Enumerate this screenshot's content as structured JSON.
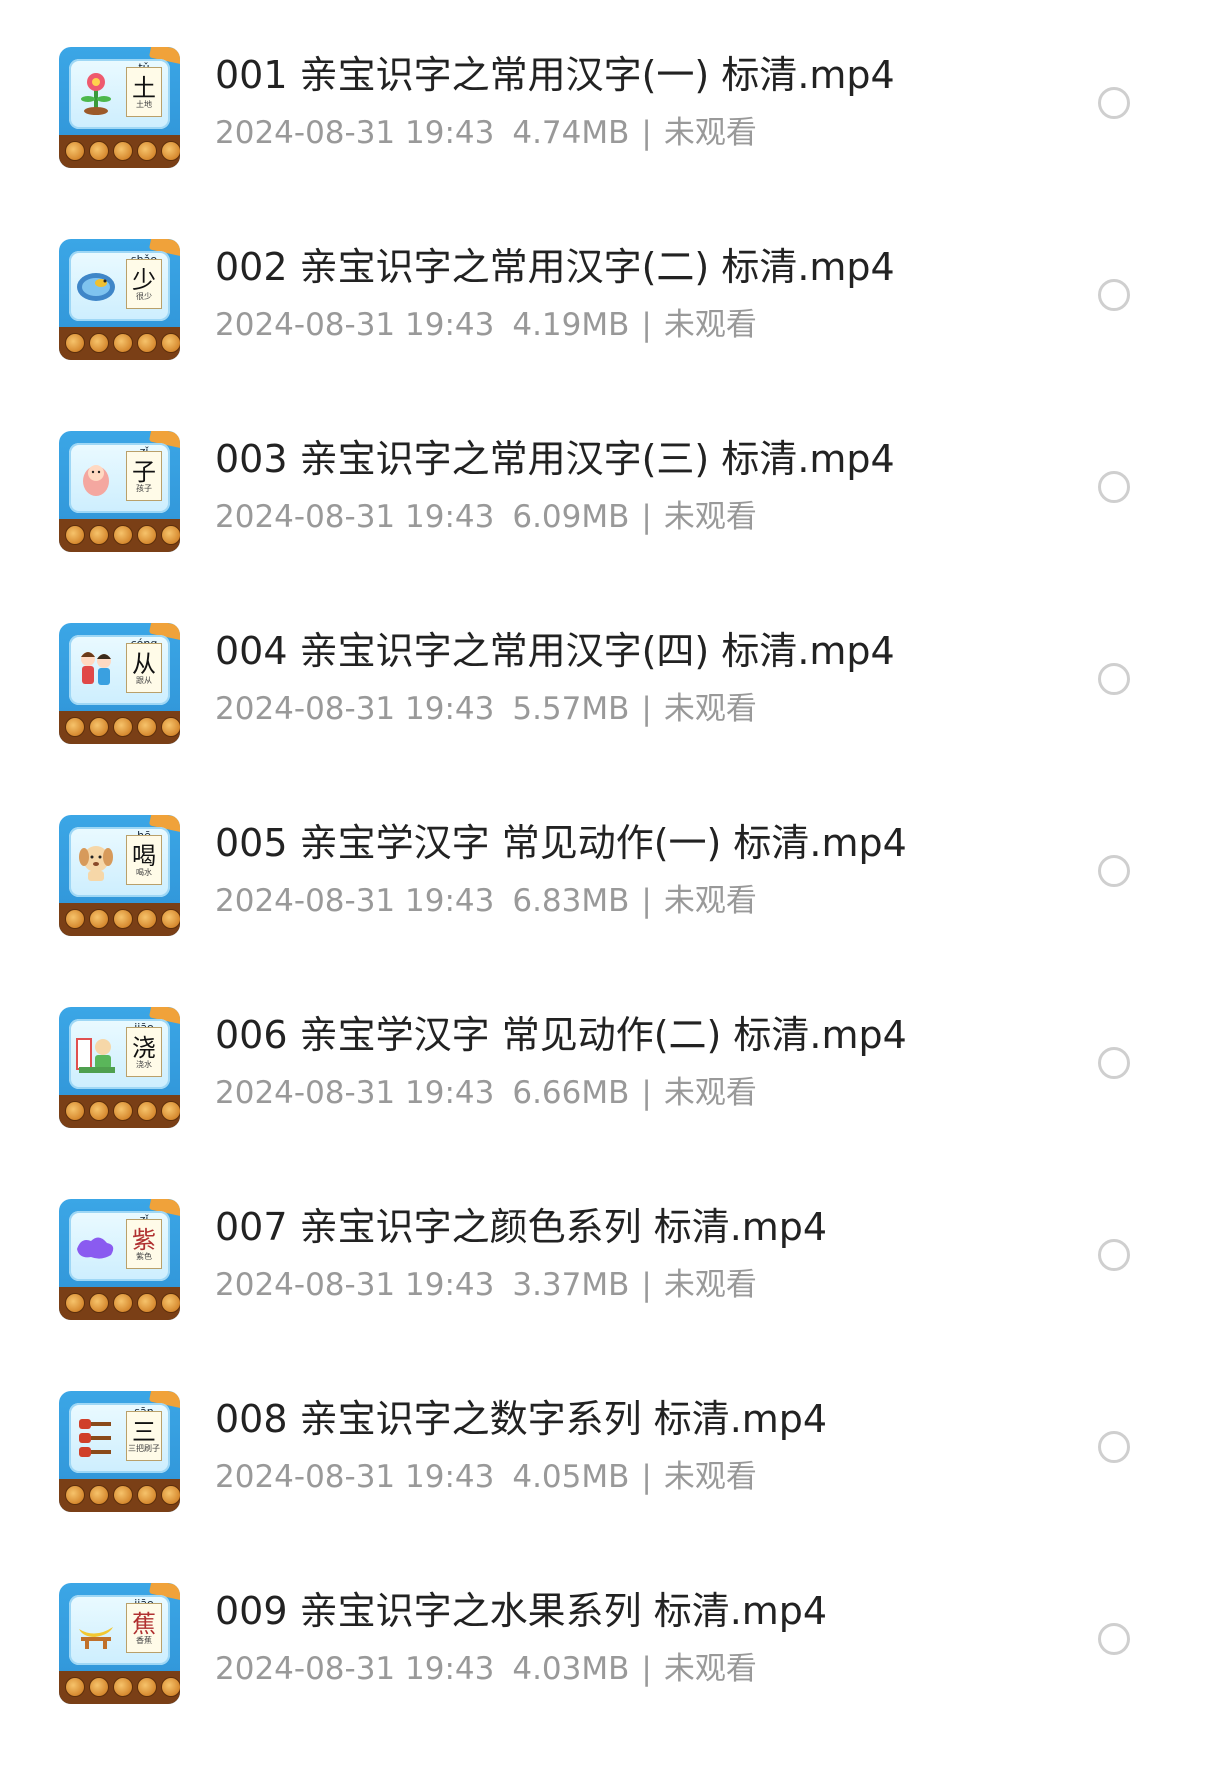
{
  "files": [
    {
      "title": "001 亲宝识字之常用汉字(一) 标清.mp4",
      "date": "2024-08-31 19:43",
      "size": "4.74MB",
      "status": "未观看",
      "thumb": {
        "pinyin": "tǔ",
        "hanzi": "土",
        "word": "土地",
        "pic": "flower-icon"
      }
    },
    {
      "title": "002 亲宝识字之常用汉字(二) 标清.mp4",
      "date": "2024-08-31 19:43",
      "size": "4.19MB",
      "status": "未观看",
      "thumb": {
        "pinyin": "shǎo",
        "hanzi": "少",
        "word": "很少",
        "pic": "pond-icon"
      }
    },
    {
      "title": "003 亲宝识字之常用汉字(三) 标清.mp4",
      "date": "2024-08-31 19:43",
      "size": "6.09MB",
      "status": "未观看",
      "thumb": {
        "pinyin": "zǐ",
        "hanzi": "子",
        "word": "孩子",
        "pic": "baby-icon"
      }
    },
    {
      "title": "004 亲宝识字之常用汉字(四) 标清.mp4",
      "date": "2024-08-31 19:43",
      "size": "5.57MB",
      "status": "未观看",
      "thumb": {
        "pinyin": "cóng",
        "hanzi": "从",
        "word": "跟从",
        "pic": "kids-icon"
      }
    },
    {
      "title": "005 亲宝学汉字 常见动作(一) 标清.mp4",
      "date": "2024-08-31 19:43",
      "size": "6.83MB",
      "status": "未观看",
      "thumb": {
        "pinyin": "hē",
        "hanzi": "喝",
        "word": "喝水",
        "pic": "puppy-icon"
      }
    },
    {
      "title": "006 亲宝学汉字 常见动作(二) 标清.mp4",
      "date": "2024-08-31 19:43",
      "size": "6.66MB",
      "status": "未观看",
      "thumb": {
        "pinyin": "jiāo",
        "hanzi": "浇",
        "word": "浇水",
        "pic": "watering-icon"
      }
    },
    {
      "title": "007 亲宝识字之颜色系列 标清.mp4",
      "date": "2024-08-31 19:43",
      "size": "3.37MB",
      "status": "未观看",
      "thumb": {
        "pinyin": "zǐ",
        "hanzi": "紫",
        "word": "紫色",
        "pic": "paint-icon"
      }
    },
    {
      "title": "008 亲宝识字之数字系列 标清.mp4",
      "date": "2024-08-31 19:43",
      "size": "4.05MB",
      "status": "未观看",
      "thumb": {
        "pinyin": "sān",
        "hanzi": "三",
        "word": "三把刷子",
        "pic": "brushes-icon"
      }
    },
    {
      "title": "009 亲宝识字之水果系列 标清.mp4",
      "date": "2024-08-31 19:43",
      "size": "4.03MB",
      "status": "未观看",
      "thumb": {
        "pinyin": "jiāo",
        "hanzi": "蕉",
        "word": "香蕉",
        "pic": "banana-icon"
      }
    }
  ],
  "colors": {
    "title": "#222222",
    "meta": "#999999",
    "radio_border": "#cfcfcf",
    "thumb_blue": "#3ba6e6",
    "thumb_wood": "#7a3f16"
  }
}
